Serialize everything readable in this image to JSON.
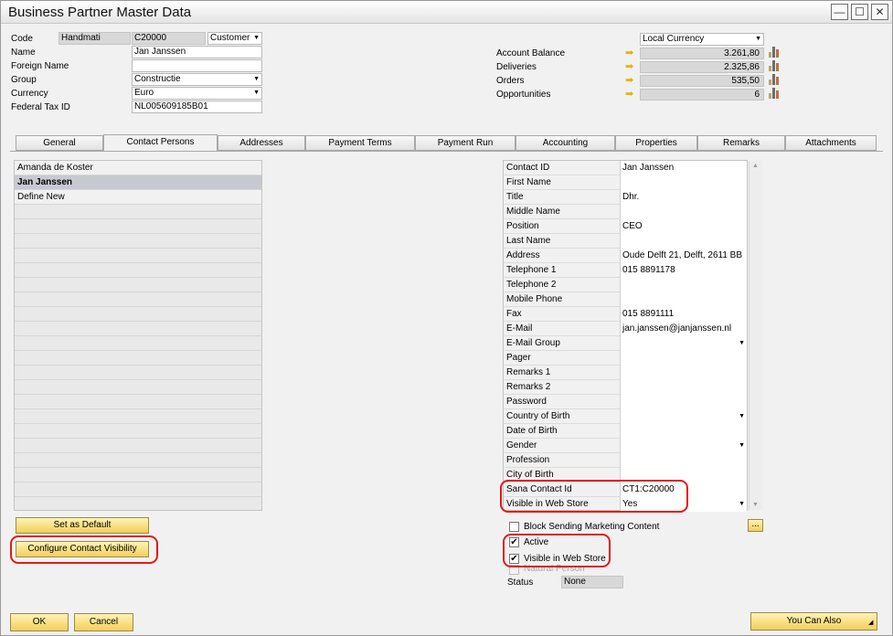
{
  "window": {
    "title": "Business Partner Master Data",
    "minimize": "—",
    "maximize": "☐",
    "close": "✕"
  },
  "header": {
    "code_label": "Code",
    "code_series": "Handmati",
    "code_value": "C20000",
    "bp_type": "Customer",
    "name_label": "Name",
    "name_value": "Jan Janssen",
    "foreign_name_label": "Foreign Name",
    "foreign_name_value": "",
    "group_label": "Group",
    "group_value": "Constructie",
    "currency_label": "Currency",
    "currency_value": "Euro",
    "tax_label": "Federal Tax ID",
    "tax_value": "NL005609185B01",
    "currency_view": "Local Currency",
    "balances": [
      {
        "label": "Account Balance",
        "value": "3.261,80"
      },
      {
        "label": "Deliveries",
        "value": "2.325,86"
      },
      {
        "label": "Orders",
        "value": "535,50"
      },
      {
        "label": "Opportunities",
        "value": "6"
      }
    ]
  },
  "tabs": [
    {
      "label": "General"
    },
    {
      "label": "Contact Persons"
    },
    {
      "label": "Addresses"
    },
    {
      "label": "Payment Terms"
    },
    {
      "label": "Payment Run"
    },
    {
      "label": "Accounting"
    },
    {
      "label": "Properties"
    },
    {
      "label": "Remarks"
    },
    {
      "label": "Attachments"
    }
  ],
  "contacts": [
    "Amanda de Koster",
    "Jan Janssen",
    "Define New"
  ],
  "details": [
    {
      "label": "Contact ID",
      "value": "Jan Janssen"
    },
    {
      "label": "First Name",
      "value": ""
    },
    {
      "label": "Title",
      "value": "Dhr."
    },
    {
      "label": "Middle Name",
      "value": ""
    },
    {
      "label": "Position",
      "value": "CEO"
    },
    {
      "label": "Last Name",
      "value": ""
    },
    {
      "label": "Address",
      "value": "Oude Delft 21, Delft, 2611 BB"
    },
    {
      "label": "Telephone 1",
      "value": "015 8891178"
    },
    {
      "label": "Telephone 2",
      "value": ""
    },
    {
      "label": "Mobile Phone",
      "value": ""
    },
    {
      "label": "Fax",
      "value": "015 8891111"
    },
    {
      "label": "E-Mail",
      "value": "jan.janssen@janjanssen.nl"
    },
    {
      "label": "E-Mail Group",
      "value": ""
    },
    {
      "label": "Pager",
      "value": ""
    },
    {
      "label": "Remarks 1",
      "value": ""
    },
    {
      "label": "Remarks 2",
      "value": ""
    },
    {
      "label": "Password",
      "value": ""
    },
    {
      "label": "Country of Birth",
      "value": ""
    },
    {
      "label": "Date of Birth",
      "value": ""
    },
    {
      "label": "Gender",
      "value": ""
    },
    {
      "label": "Profession",
      "value": ""
    },
    {
      "label": "City of Birth",
      "value": ""
    },
    {
      "label": "Sana Contact Id",
      "value": "CT1:C20000"
    },
    {
      "label": "Visible in Web Store",
      "value": "Yes"
    }
  ],
  "buttons": {
    "set_default": "Set as Default",
    "configure_visibility": "Configure Contact Visibility",
    "ok": "OK",
    "cancel": "Cancel",
    "you_can_also": "You Can Also",
    "ellipsis": "..."
  },
  "checks": {
    "block_marketing": "Block Sending Marketing Content",
    "active": "Active",
    "visible_web_store": "Visible in Web Store",
    "natural_person": "Natural Person",
    "status_label": "Status",
    "status_value": "None"
  },
  "colors": {
    "highlight": "#e01a1a",
    "button_yellow": "#f2cf5a",
    "selected_row": "#c7c9d1"
  }
}
